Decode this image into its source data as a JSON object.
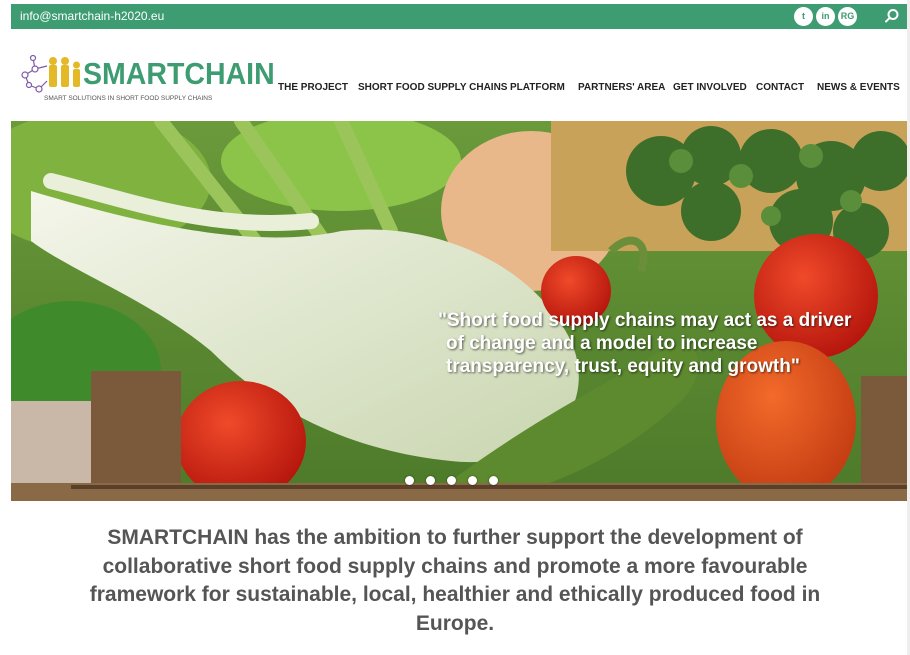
{
  "topbar": {
    "email": "info@smartchain-h2020.eu",
    "social": [
      {
        "icon": "twitter-icon",
        "glyph": "t"
      },
      {
        "icon": "linkedin-icon",
        "glyph": "in"
      },
      {
        "icon": "researchgate-icon",
        "glyph": "RG"
      }
    ],
    "search_icon": "search-icon"
  },
  "logo": {
    "title": "SMARTCHAIN",
    "subtitle": "SMART SOLUTIONS IN SHORT FOOD SUPPLY CHAINS"
  },
  "nav": [
    "THE PROJECT",
    "SHORT FOOD SUPPLY CHAINS",
    "PLATFORM",
    "PARTNERS' AREA",
    "GET INVOLVED",
    "CONTACT",
    "NEWS & EVENTS"
  ],
  "hero": {
    "quote_lines": [
      "\"Short food supply chains may act as a driver",
      "of change and a model to increase",
      "transparency, trust, equity and growth\""
    ],
    "slides": 5,
    "active_slide": 1
  },
  "intro": {
    "text": "SMARTCHAIN has the ambition to further support the development of collaborative short food supply chains and promote a more favourable framework for sustainable, local, healthier and ethically produced food in Europe."
  },
  "colors": {
    "brand": "#3e9c72",
    "intro_text": "#555555"
  }
}
